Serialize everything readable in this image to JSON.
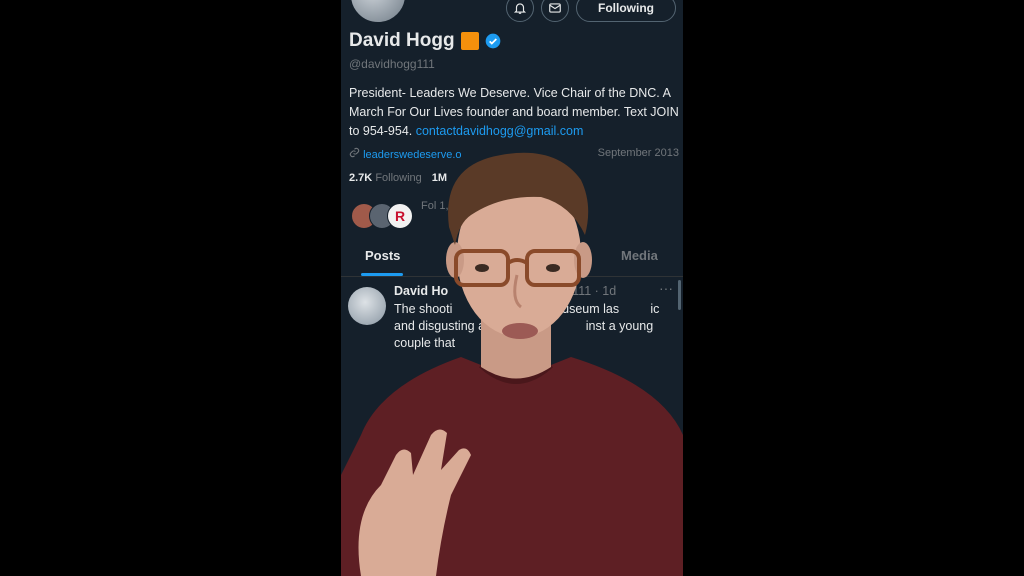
{
  "profile": {
    "follow_button": "Following",
    "name": "David Hogg",
    "handle": "@davidhogg111",
    "bio_text": "President- Leaders We Deserve. Vice Chair of the DNC. A March For Our Lives founder and board member. Text JOIN to 954-954.",
    "bio_email": "contactdavidhogg@gmail.com",
    "website": "leaderswedeserve.o",
    "joined_fragment": "September 2013",
    "following_count": "2.7K",
    "following_label": "Following",
    "followers_count": "1M",
    "followed_by_text": "Fol  1, Right Angle Ne"
  },
  "tabs": {
    "posts": "Posts",
    "media": "Media"
  },
  "post": {
    "author": "David Ho",
    "meta": "111 · 1d",
    "more": "···",
    "text": "The shooti         pital Jewish Museum las         ic and disgusting act of hatred           inst a young couple that           ged."
  },
  "colors": {
    "background": "#15202b",
    "accent": "#1d9bf0",
    "muted": "#71767b",
    "badge_orange": "#f4900c"
  },
  "icons": {
    "notification": "bell-plus-icon",
    "message": "envelope-icon",
    "verified": "verified-badge-icon",
    "link": "link-icon"
  }
}
